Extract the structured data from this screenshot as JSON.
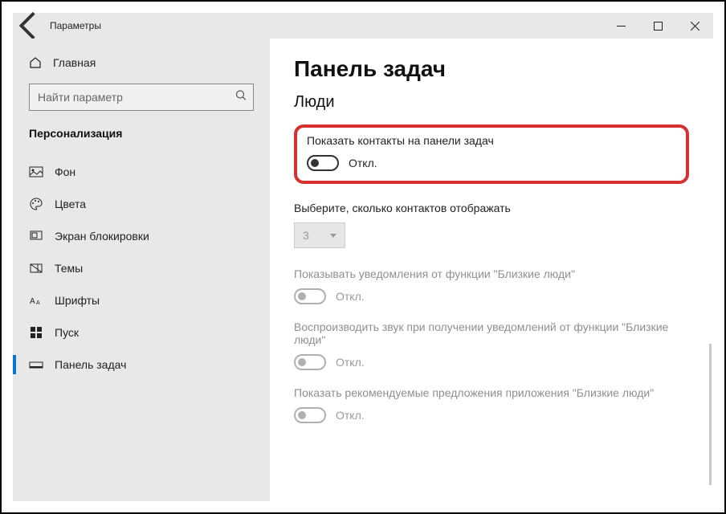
{
  "window": {
    "title": "Параметры"
  },
  "sidebar": {
    "home": "Главная",
    "searchPlaceholder": "Найти параметр",
    "section": "Персонализация",
    "items": [
      {
        "label": "Фон"
      },
      {
        "label": "Цвета"
      },
      {
        "label": "Экран блокировки"
      },
      {
        "label": "Темы"
      },
      {
        "label": "Шрифты"
      },
      {
        "label": "Пуск"
      },
      {
        "label": "Панель задач"
      }
    ]
  },
  "content": {
    "heading": "Панель задач",
    "subheading": "Люди",
    "contacts": {
      "label": "Показать контакты на панели задач",
      "state": "Откл."
    },
    "count": {
      "label": "Выберите, сколько контактов отображать",
      "value": "3"
    },
    "notif": {
      "label": "Показывать уведомления от функции \"Близкие люди\"",
      "state": "Откл."
    },
    "sound": {
      "label": "Воспроизводить звук при получении уведомлений от функции \"Близкие люди\"",
      "state": "Откл."
    },
    "suggest": {
      "label": "Показать рекомендуемые предложения приложения \"Близкие люди\"",
      "state": "Откл."
    }
  }
}
